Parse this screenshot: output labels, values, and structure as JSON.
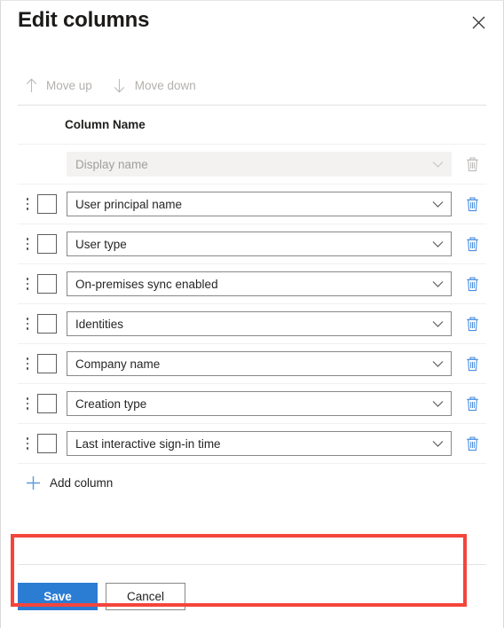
{
  "dialog": {
    "title": "Edit columns",
    "close_icon": "close-icon"
  },
  "toolbar": {
    "move_up": {
      "label": "Move up",
      "icon": "arrow-up-icon",
      "disabled": true
    },
    "move_down": {
      "label": "Move down",
      "icon": "arrow-down-icon",
      "disabled": true
    }
  },
  "list": {
    "column_header": "Column Name",
    "rows": [
      {
        "value": "Display name",
        "disabled": true,
        "has_handle": false,
        "has_checkbox": false,
        "delete_icon": "trash-icon"
      },
      {
        "value": "User principal name",
        "disabled": false,
        "has_handle": true,
        "has_checkbox": true,
        "delete_icon": "trash-icon"
      },
      {
        "value": "User type",
        "disabled": false,
        "has_handle": true,
        "has_checkbox": true,
        "delete_icon": "trash-icon"
      },
      {
        "value": "On-premises sync enabled",
        "disabled": false,
        "has_handle": true,
        "has_checkbox": true,
        "delete_icon": "trash-icon"
      },
      {
        "value": "Identities",
        "disabled": false,
        "has_handle": true,
        "has_checkbox": true,
        "delete_icon": "trash-icon"
      },
      {
        "value": "Company name",
        "disabled": false,
        "has_handle": true,
        "has_checkbox": true,
        "delete_icon": "trash-icon"
      },
      {
        "value": "Creation type",
        "disabled": false,
        "has_handle": true,
        "has_checkbox": true,
        "delete_icon": "trash-icon"
      },
      {
        "value": "Last interactive sign-in time",
        "disabled": false,
        "has_handle": true,
        "has_checkbox": true,
        "delete_icon": "trash-icon"
      }
    ],
    "add_column": {
      "label": "Add column",
      "icon": "plus-icon"
    }
  },
  "annotation": {
    "shape": "rectangle",
    "color": "#f4453c"
  },
  "footer": {
    "save": "Save",
    "cancel": "Cancel"
  },
  "colors": {
    "accent_blue": "#2b7cd3",
    "icon_blue": "#4a8ee0",
    "disabled_gray": "#a19f9d",
    "annotation_red": "#f4453c"
  }
}
